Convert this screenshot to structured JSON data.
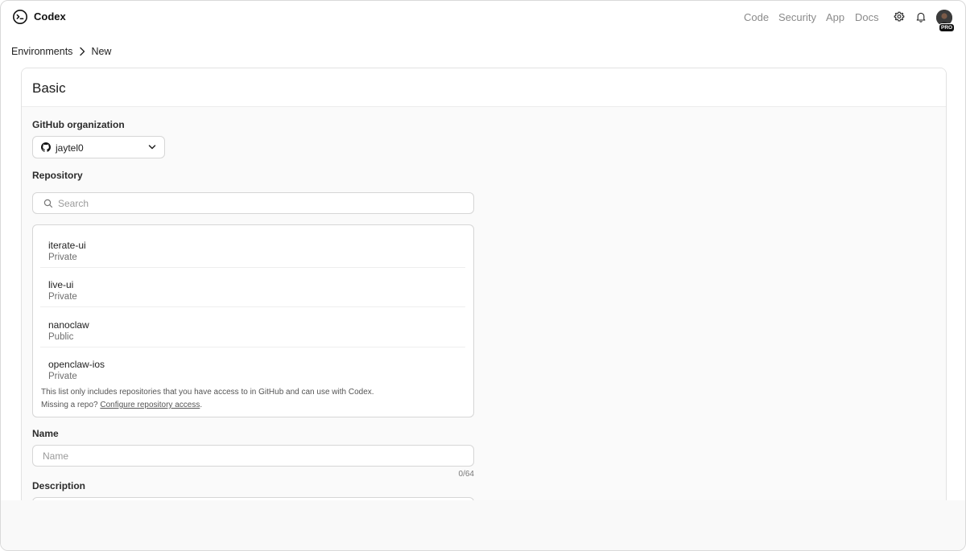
{
  "header": {
    "brand": "Codex",
    "nav": [
      "Code",
      "Security",
      "App",
      "Docs"
    ],
    "badge": "PRO"
  },
  "breadcrumb": {
    "parent": "Environments",
    "current": "New"
  },
  "card": {
    "title": "Basic",
    "org_label": "GitHub organization",
    "org_value": "jaytel0",
    "repo_label": "Repository",
    "search_placeholder": "Search",
    "repos": [
      {
        "name": "iterate-ui",
        "visibility": "Private"
      },
      {
        "name": "live-ui",
        "visibility": "Private"
      },
      {
        "name": "nanoclaw",
        "visibility": "Public"
      },
      {
        "name": "openclaw-ios",
        "visibility": "Private"
      }
    ],
    "note_line1": "This list only includes repositories that you have access to in GitHub and can use with Codex.",
    "note_line2_prefix": "Missing a repo? ",
    "note_link": "Configure repository access",
    "note_line2_suffix": ".",
    "name_label": "Name",
    "name_placeholder": "Name",
    "name_counter": "0/64",
    "description_label": "Description"
  }
}
